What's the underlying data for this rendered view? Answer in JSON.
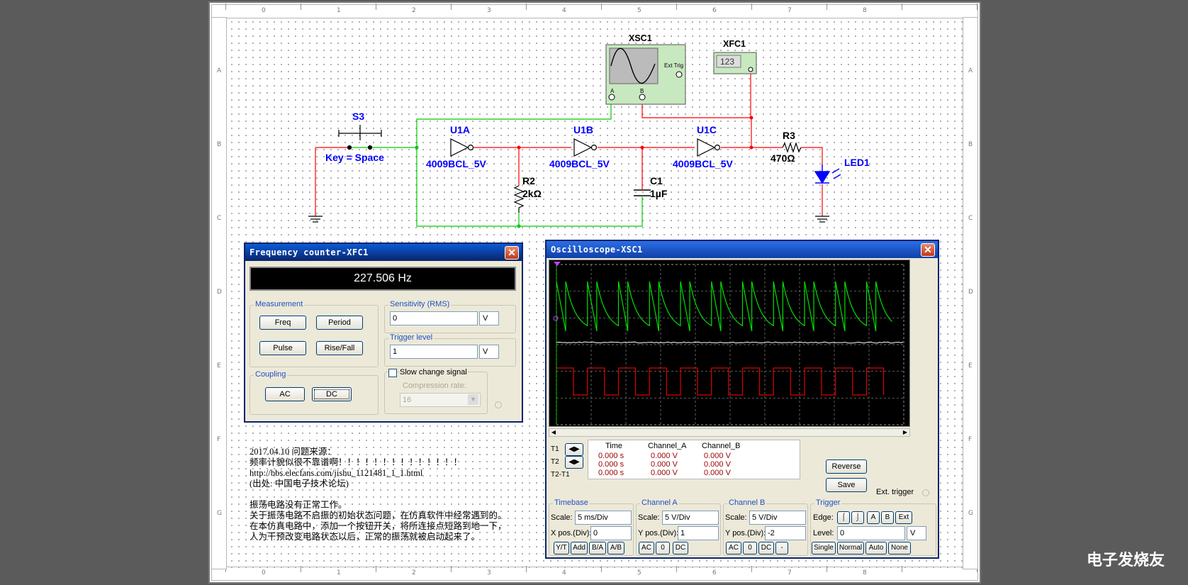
{
  "rulers": {
    "columns": [
      "0",
      "1",
      "2",
      "3",
      "4",
      "5",
      "6",
      "7",
      "8"
    ],
    "rows": [
      "A",
      "B",
      "C",
      "D",
      "E",
      "F",
      "G"
    ]
  },
  "schematic": {
    "switch": {
      "ref": "S3",
      "key": "Key = Space"
    },
    "gates": [
      {
        "ref": "U1A",
        "part": "4009BCL_5V"
      },
      {
        "ref": "U1B",
        "part": "4009BCL_5V"
      },
      {
        "ref": "U1C",
        "part": "4009BCL_5V"
      }
    ],
    "r2": {
      "ref": "R2",
      "value": "2kΩ"
    },
    "c1": {
      "ref": "C1",
      "value": "1µF"
    },
    "r3": {
      "ref": "R3",
      "value": "470Ω"
    },
    "led": {
      "ref": "LED1"
    },
    "scope": {
      "ref": "XSC1",
      "ext_trig": "Ext Trig",
      "ch_a": "A",
      "ch_b": "B"
    },
    "counter": {
      "ref": "XFC1",
      "display": "123"
    },
    "colors": {
      "wire_red": "#ff0000",
      "wire_green": "#00cc00",
      "component_blue": "#0000ff",
      "instrument_green": "#c8e8c0"
    }
  },
  "freq_counter": {
    "title": "Frequency counter-XFC1",
    "reading": "227.506 Hz",
    "measurement": {
      "label": "Measurement",
      "buttons": [
        "Freq",
        "Period",
        "Pulse",
        "Rise/Fall"
      ]
    },
    "coupling": {
      "label": "Coupling",
      "buttons": [
        "AC",
        "DC"
      ]
    },
    "sensitivity": {
      "label": "Sensitivity (RMS)",
      "value": "0",
      "unit": "V"
    },
    "trigger_level": {
      "label": "Trigger level",
      "value": "1",
      "unit": "V"
    },
    "slow_change": {
      "label": "Slow change signal",
      "checked": false
    },
    "compression": {
      "label": "Compression rate:",
      "value": "16"
    }
  },
  "oscilloscope": {
    "title": "Oscilloscope-XSC1",
    "readout": {
      "headers": [
        "Time",
        "Channel_A",
        "Channel_B"
      ],
      "rows": [
        {
          "label": "T1",
          "time": "0.000 s",
          "a": "0.000 V",
          "b": "0.000 V"
        },
        {
          "label": "T2",
          "time": "0.000 s",
          "a": "0.000 V",
          "b": "0.000 V"
        },
        {
          "label": "T2-T1",
          "time": "0.000 s",
          "a": "0.000 V",
          "b": "0.000 V"
        }
      ]
    },
    "buttons": {
      "reverse": "Reverse",
      "save": "Save",
      "ext_trigger": "Ext. trigger"
    },
    "timebase": {
      "label": "Timebase",
      "scale_label": "Scale:",
      "scale": "5 ms/Div",
      "pos_label": "X pos.(Div):",
      "pos": "0",
      "modes": [
        "Y/T",
        "Add",
        "B/A",
        "A/B"
      ]
    },
    "channel_a": {
      "label": "Channel A",
      "scale_label": "Scale:",
      "scale": "5 V/Div",
      "pos_label": "Y pos.(Div):",
      "pos": "1",
      "coupling": [
        "AC",
        "0",
        "DC"
      ]
    },
    "channel_b": {
      "label": "Channel B",
      "scale_label": "Scale:",
      "scale": "5 V/Div",
      "pos_label": "Y pos.(Div):",
      "pos": "-2",
      "coupling": [
        "AC",
        "0",
        "DC",
        "-"
      ]
    },
    "trigger": {
      "label": "Trigger",
      "edge_label": "Edge:",
      "edge_buttons": [
        "A",
        "B",
        "Ext"
      ],
      "level_label": "Level:",
      "level": "0",
      "level_unit": "V",
      "modes": [
        "Single",
        "Normal",
        "Auto",
        "None"
      ]
    },
    "trace_colors": {
      "channel_a": "#00e000",
      "channel_b": "#e00000",
      "trigger": "#ffffff"
    }
  },
  "notes": [
    "2017.04.10  问题来源：",
    "频率计貌似很不靠谱啊！！！！！！！！！！！！！！",
    "http://bbs.elecfans.com/jishu_1121481_1_1.html",
    "(出处: 中国电子技术论坛)",
    "",
    "振荡电路没有正常工作。",
    "关于振荡电路不启振的初始状态问题，在仿真软件中经常遇到的。",
    "在本仿真电路中，添加一个按钮开关，将所连接点短路到地一下，",
    "人为干预改变电路状态以后，正常的振荡就被启动起来了。"
  ],
  "watermark": "电子发烧友"
}
